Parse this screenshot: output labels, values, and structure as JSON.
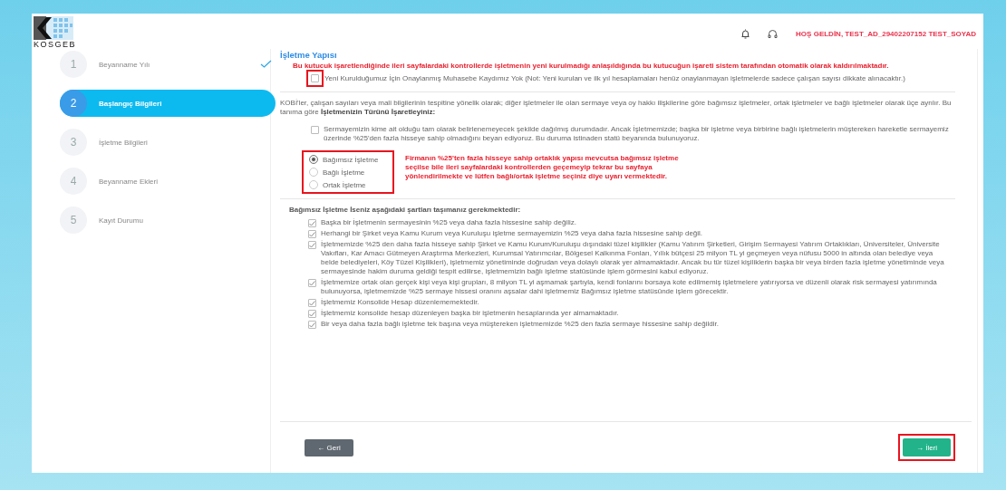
{
  "header": {
    "logo": "KOSGEB",
    "welcome": "HOŞ GELDİN, TEST_AD_29402207152 TEST_SOYAD"
  },
  "steps": [
    {
      "number": "1",
      "label": "Beyanname Yılı",
      "selected": false,
      "completed": true
    },
    {
      "number": "2",
      "label": "Başlangıç Bilgileri",
      "selected": true,
      "completed": false
    },
    {
      "number": "3",
      "label": "İşletme Bilgileri",
      "selected": false,
      "completed": false
    },
    {
      "number": "4",
      "label": "Beyanname Ekleri",
      "selected": false,
      "completed": false
    },
    {
      "number": "5",
      "label": "Kayıt Durumu",
      "selected": false,
      "completed": false
    }
  ],
  "section_title": "İşletme Yapısı",
  "new_company": {
    "note": "Bu kutucuk işaretlendiğinde ileri sayfalardaki kontrollerde işletmenin yeni kurulmadığı anlaşıldığında bu kutucuğun işareti sistem tarafından otomatik olarak kaldırılmaktadır.",
    "label": "Yeni Kurulduğumuz İçin Onaylanmış Muhasebe Kaydımız Yok (Not: Yeni kurulan ve ilk yıl hesaplamaları henüz onaylanmayan işletmelerde sadece çalışan sayısı dikkate alınacaktır.)",
    "checked": false,
    "annotated": true
  },
  "intro": "KOBİ'ler, çalışan sayıları veya mali bilgilerinin tespitine yönelik olarak; diğer işletmeler ile olan sermaye veya oy hakkı ilişkilerine göre bağımsız işletmeler, ortak işletmeler ve bağlı işletmeler olarak üçe ayrılır. Bu tanıma göre **İşletmenizin Türünü İşaretleyiniz:**",
  "dispersed_capital": {
    "label": "Sermayemizin kime ait olduğu tam olarak belirlenemeyecek şekilde dağılmış durumdadır. Ancak İşletmemizde; başka bir işletme veya birbirine bağlı işletmelerin müştereken hareketle sermayemiz üzerinde %25'den fazla hisseye sahip olmadığını beyan ediyoruz. Bu duruma istinaden statü beyanında bulunuyoruz.",
    "checked": false
  },
  "company_types": {
    "annotated": true,
    "options": [
      {
        "label": "Bağımsız İşletme",
        "selected": true
      },
      {
        "label": "Bağlı İşletme",
        "selected": false
      },
      {
        "label": "Ortak İşletme",
        "selected": false
      }
    ]
  },
  "warning_note": "Firmanın %25'ten fazla hisseye sahip ortaklık yapısı mevcutsa bağımsız işletme seçilse bile ileri sayfalardaki kontrollerden geçemeyip tekrar bu sayfaya yönlendirilmekte ve lütfen bağlı/ortak işletme seçiniz diye uyarı vermektedir.",
  "conditions_title": "Bağımsız İşletme İseniz aşağıdaki şartları taşımanız gerekmektedir:",
  "conditions": [
    {
      "text": "Başka bir İşletmenin sermayesinin %25 veya daha fazla hissesine sahip değiliz.",
      "checked": true
    },
    {
      "text": "Herhangi bir Şirket veya Kamu Kurum veya Kuruluşu işletme sermayemizin %25 veya daha fazla hissesine sahip değil.",
      "checked": true
    },
    {
      "text": "İşletmemizde %25 den daha fazla hisseye sahip Şirket ve Kamu Kurum/Kuruluşu dışındaki tüzel kişilikler (Kamu Yatırım Şirketleri, Girişim Sermayesi Yatırım Ortaklıkları, Üniversiteler, Üniversite Vakıfları, Kar Amacı Gütmeyen Araştırma Merkezleri, Kurumsal Yatırımcılar, Bölgesel Kalkınma Fonları, Yıllık bütçesi 25 milyon TL yi geçmeyen veya nüfusu 5000 in altında olan belediye veya belde belediyeleri, Köy Tüzel Kişilikleri), işletmemiz yönetiminde doğrudan veya dolaylı olarak yer almamaktadır. Ancak bu tür tüzel kişiliklerin başka bir veya birden fazla işletme yönetiminde veya sermayesinde hakim duruma geldiği tespit edilirse, işletmemizin bağlı işletme statüsünde işlem görmesini kabul ediyoruz.",
      "checked": true
    },
    {
      "text": "İşletmemize ortak olan gerçek kişi veya kişi grupları, 8 milyon TL yi aşmamak şartıyla, kendi fonlarını borsaya kote edilmemiş işletmelere yatırıyorsa ve düzenli olarak risk sermayesi yatırımında bulunuyorsa, işletmemizde %25 sermaye hissesi oranını aşsalar dahi işletmemiz Bağımsız işletme statüsünde işlem görecektir.",
      "checked": true
    },
    {
      "text": "İşletmemiz Konsolide Hesap düzenlememektedir.",
      "checked": true
    },
    {
      "text": "İşletmemiz konsolide hesap düzenleyen başka bir işletmenin hesaplarında yer almamaktadır.",
      "checked": true
    },
    {
      "text": "Bir veya daha fazla bağlı işletme tek başına veya müştereken işletmemizde %25 den fazla sermaye hissesine sahip değildir.",
      "checked": true
    }
  ],
  "buttons": {
    "back": "← Geri",
    "next": "→ İleri",
    "next_annotated": true
  }
}
